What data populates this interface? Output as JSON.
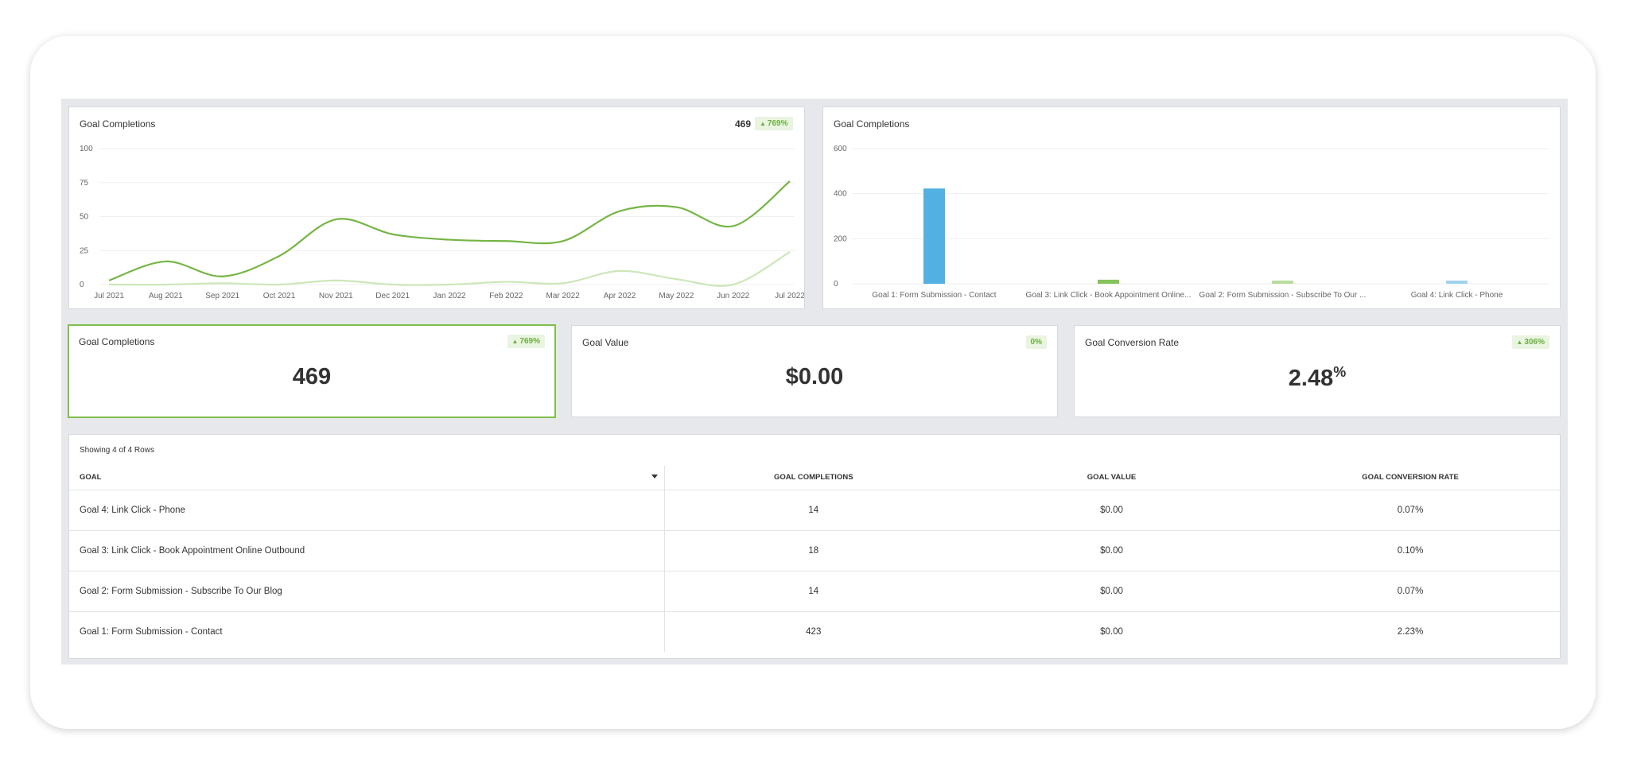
{
  "line_panel": {
    "title": "Goal Completions",
    "total": "469",
    "change": "769%"
  },
  "bar_panel": {
    "title": "Goal Completions"
  },
  "kpis": [
    {
      "title": "Goal Completions",
      "value": "469",
      "change": "769%"
    },
    {
      "title": "Goal Value",
      "value": "$0.00",
      "change": "0%"
    },
    {
      "title": "Goal Conversion Rate",
      "value": "2.48",
      "unit": "%",
      "change": "306%"
    }
  ],
  "table": {
    "showing": "Showing 4 of 4 Rows",
    "headers": [
      "GOAL",
      "GOAL COMPLETIONS",
      "GOAL VALUE",
      "GOAL CONVERSION RATE"
    ],
    "rows": [
      [
        "Goal 4: Link Click - Phone",
        "14",
        "$0.00",
        "0.07%"
      ],
      [
        "Goal 3: Link Click - Book Appointment Online Outbound",
        "18",
        "$0.00",
        "0.10%"
      ],
      [
        "Goal 2: Form Submission - Subscribe To Our Blog",
        "14",
        "$0.00",
        "0.07%"
      ],
      [
        "Goal 1: Form Submission - Contact",
        "423",
        "$0.00",
        "2.23%"
      ]
    ]
  },
  "colors": {
    "primary_line": "#76b545",
    "secondary_line": "#cde7b8",
    "bar_blue": "#52b1e2",
    "bar_green": "#86c45a",
    "bar_light_green": "#b7dc9b",
    "bar_light_blue": "#9ed3f0",
    "accent_green": "#6cae3e"
  },
  "chart_data": [
    {
      "type": "line",
      "title": "Goal Completions",
      "x": [
        "Jul 2021",
        "Aug 2021",
        "Sep 2021",
        "Oct 2021",
        "Nov 2021",
        "Dec 2021",
        "Jan 2022",
        "Feb 2022",
        "Mar 2022",
        "Apr 2022",
        "May 2022",
        "Jun 2022",
        "Jul 2022"
      ],
      "yticks": [
        0,
        25,
        50,
        75,
        100
      ],
      "ylim": [
        0,
        100
      ],
      "series": [
        {
          "values": [
            3,
            17,
            6,
            21,
            48,
            37,
            33,
            32,
            32,
            54,
            57,
            43,
            76
          ]
        },
        {
          "values": [
            0,
            0,
            1,
            0,
            3,
            0,
            0,
            2,
            1,
            10,
            4,
            0,
            24
          ]
        }
      ],
      "grid": true
    },
    {
      "type": "bar",
      "title": "Goal Completions",
      "categories": [
        "Goal 1: Form Submission - Contact",
        "Goal 3: Link Click - Book Appointment Online...",
        "Goal 2: Form Submission - Subscribe To Our ...",
        "Goal 4: Link Click - Phone"
      ],
      "values": [
        423,
        18,
        14,
        14
      ],
      "yticks": [
        0,
        200,
        400,
        600
      ],
      "ylim": [
        0,
        600
      ],
      "grid": true
    }
  ]
}
